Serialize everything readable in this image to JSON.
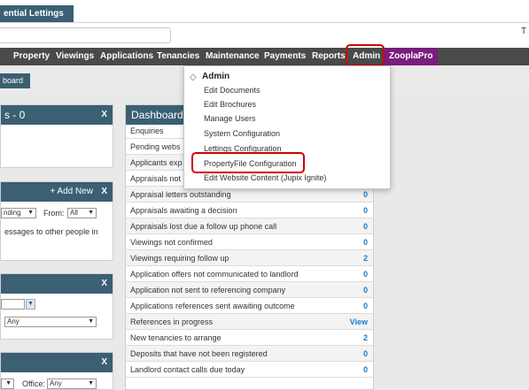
{
  "app": {
    "brand": "ential Lettings",
    "top_right_char": "T"
  },
  "nav": {
    "items": [
      "Property",
      "Viewings",
      "Applications",
      "Tenancies",
      "Maintenance",
      "Payments",
      "Reports",
      "Admin"
    ],
    "zoopla": "ZooplaPro"
  },
  "subnav": {
    "dashboard_tab": "board"
  },
  "admin_menu": {
    "header": "Admin",
    "items": [
      "Edit Documents",
      "Edit Brochures",
      "Manage Users",
      "System Configuration",
      "Lettings Configuration",
      "PropertyFile Configuration",
      "Edit Website Content (Jupix Ignite)"
    ]
  },
  "left_panels": {
    "p1": {
      "title": "s - 0",
      "close": "X"
    },
    "p2": {
      "add_new": "+ Add New",
      "close": "X",
      "filter_value": "nding",
      "from_label": "From:",
      "from_value": "All",
      "text": "essages to other people in"
    },
    "p3": {
      "close": "X",
      "select_value": "Any"
    },
    "p4": {
      "close": "X",
      "office_label": "Office:",
      "office_value": "Any"
    }
  },
  "dashboard": {
    "title": "Dashboard",
    "close": "X",
    "rows": [
      {
        "label": "Enquiries",
        "value": ""
      },
      {
        "label": "Pending webs",
        "value": ""
      },
      {
        "label": "Applicants exp",
        "value": ""
      },
      {
        "label": "Appraisals not",
        "value": ""
      },
      {
        "label": "Appraisal letters outstanding",
        "value": "0"
      },
      {
        "label": "Appraisals awaiting a decision",
        "value": "0"
      },
      {
        "label": "Appraisals lost due a follow up phone call",
        "value": "0"
      },
      {
        "label": "Viewings not confirmed",
        "value": "0"
      },
      {
        "label": "Viewings requiring follow up",
        "value": "2"
      },
      {
        "label": "Application offers not communicated to landlord",
        "value": "0"
      },
      {
        "label": "Application not sent to referencing company",
        "value": "0"
      },
      {
        "label": "Applications references sent awaiting outcome",
        "value": "0"
      },
      {
        "label": "References in progress",
        "value": "View"
      },
      {
        "label": "New tenancies to arrange",
        "value": "2"
      },
      {
        "label": "Deposits that have not been registered",
        "value": "0"
      },
      {
        "label": "Landlord contact calls due today",
        "value": "0"
      }
    ]
  }
}
